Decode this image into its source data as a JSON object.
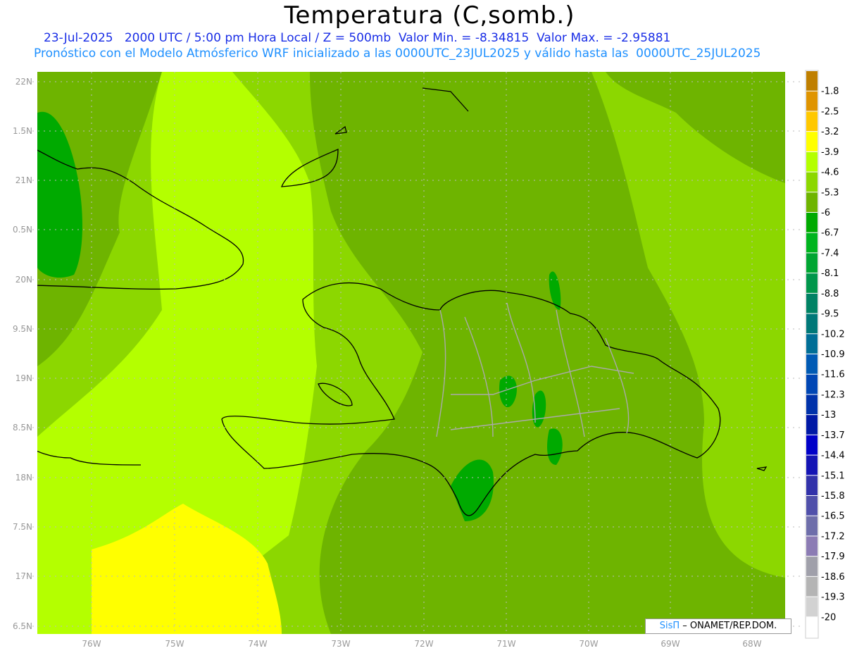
{
  "title": "Temperatura (C,somb.)",
  "subtitle_line1": "23-Jul-2025   2000 UTC / 5:00 pm Hora Local / Z = 500mb  Valor Min. = -8.34815  Valor Max. = -2.95881",
  "subtitle_line2": "Pronóstico con el Modelo Atmósferico WRF inicializado a las 0000UTC_23JUL2025 y válido hasta las  0000UTC_25JUL2025",
  "lat_labels": [
    "22N",
    "1.5N",
    "21N",
    "0.5N",
    "20N",
    "9.5N",
    "19N",
    "8.5N",
    "18N",
    "7.5N",
    "17N",
    "6.5N"
  ],
  "lon_labels": [
    "76W",
    "75W",
    "74W",
    "73W",
    "72W",
    "71W",
    "70W",
    "69W",
    "68W"
  ],
  "colorbar": {
    "labels": [
      "-1.8",
      "-2.5",
      "-3.2",
      "-3.9",
      "-4.6",
      "-5.3",
      "-6",
      "-6.7",
      "-7.4",
      "-8.1",
      "-8.8",
      "-9.5",
      "-10.2",
      "-10.9",
      "-11.6",
      "-12.3",
      "-13",
      "-13.7",
      "-14.4",
      "-15.1",
      "-15.8",
      "-16.5",
      "-17.2",
      "-17.9",
      "-18.6",
      "-19.3",
      "-20"
    ],
    "colors": [
      "#bf7f00",
      "#df9400",
      "#ffc800",
      "#ffff00",
      "#b4ff00",
      "#8cd700",
      "#6eb400",
      "#00aa00",
      "#00b41e",
      "#00a532",
      "#00964b",
      "#008264",
      "#007878",
      "#006e96",
      "#005ab4",
      "#0046b4",
      "#0032aa",
      "#0019a5",
      "#0000c8",
      "#1414b4",
      "#3232aa",
      "#5050aa",
      "#6e6eaa",
      "#8c7cb4",
      "#a0a0aa",
      "#b4b4b4",
      "#d2d2d2",
      "#ffffff"
    ]
  },
  "watermark": {
    "brand": "SisΠ",
    "text": "– ONAMET/REP.DOM."
  }
}
